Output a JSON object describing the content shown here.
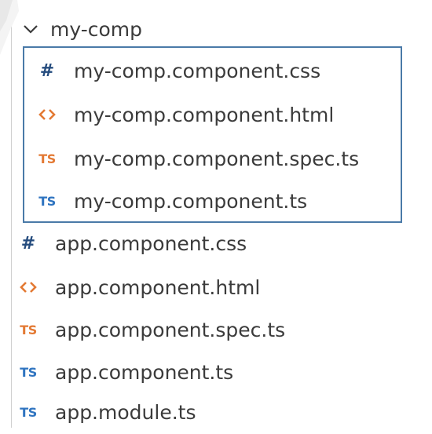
{
  "folder": {
    "name": "my-comp",
    "icon": "chevron-down-icon"
  },
  "selected_files": [
    {
      "name": "my-comp.component.css",
      "icon": "css-hash-icon",
      "glyph": "#",
      "color": "#254c7e"
    },
    {
      "name": "my-comp.component.html",
      "icon": "html-brackets-icon",
      "glyph": "",
      "color": "#e37933"
    },
    {
      "name": "my-comp.component.spec.ts",
      "icon": "ts-spec-icon",
      "glyph": "TS",
      "color": "#e37933"
    },
    {
      "name": "my-comp.component.ts",
      "icon": "ts-icon",
      "glyph": "TS",
      "color": "#2f74c0"
    }
  ],
  "files": [
    {
      "name": "app.component.css",
      "icon": "css-hash-icon",
      "glyph": "#",
      "color": "#254c7e"
    },
    {
      "name": "app.component.html",
      "icon": "html-brackets-icon",
      "glyph": "",
      "color": "#e37933"
    },
    {
      "name": "app.component.spec.ts",
      "icon": "ts-spec-icon",
      "glyph": "TS",
      "color": "#e37933"
    },
    {
      "name": "app.component.ts",
      "icon": "ts-icon",
      "glyph": "TS",
      "color": "#2f74c0"
    },
    {
      "name": "app.module.ts",
      "icon": "ts-icon",
      "glyph": "TS",
      "color": "#2f74c0"
    }
  ],
  "selection_border_color": "#4a7aa8"
}
